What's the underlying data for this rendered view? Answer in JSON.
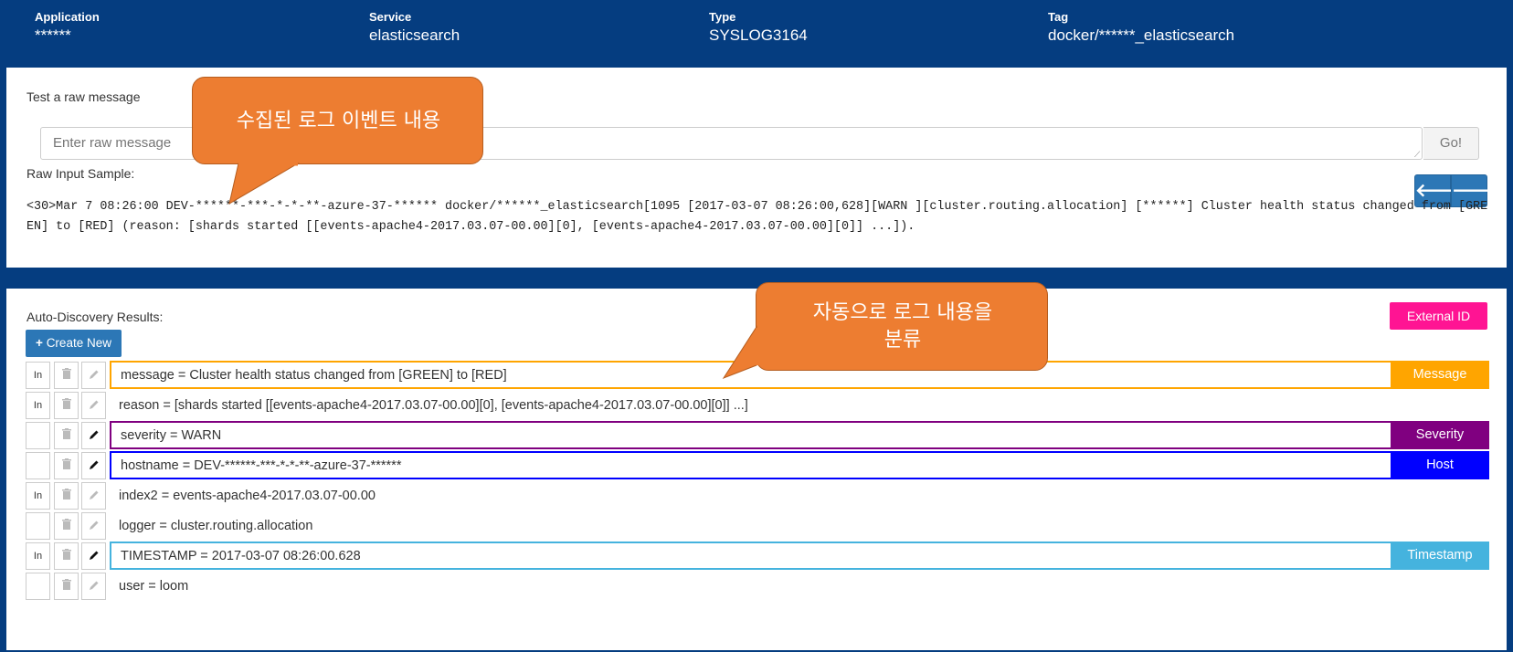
{
  "header": {
    "application": {
      "label": "Application",
      "value": "******"
    },
    "service": {
      "label": "Service",
      "value": "elasticsearch"
    },
    "type": {
      "label": "Type",
      "value": "SYSLOG3164"
    },
    "tag": {
      "label": "Tag",
      "value": "docker/******_elasticsearch"
    }
  },
  "test_panel": {
    "title": "Test a raw message",
    "input_placeholder": "Enter raw message",
    "go_label": "Go!",
    "sample_label": "Raw Input Sample:",
    "prev_icon": "arrow-left-icon",
    "next_icon": "arrow-right-icon",
    "sample_text": "<30>Mar 7 08:26:00 DEV-******-***-*-*-**-azure-37-****** docker/******_elasticsearch[1095 [2017-03-07 08:26:00,628][WARN ][cluster.routing.allocation] [******] Cluster health status changed from [GREEN] to [RED] (reason: [shards started [[events-apache4-2017.03.07-00.00][0], [events-apache4-2017.03.07-00.00][0]] ...])."
  },
  "callouts": {
    "top": "수집된 로그 이벤트 내용",
    "bottom_line1": "자동으로 로그 내용을",
    "bottom_line2": "분류"
  },
  "discovery": {
    "title": "Auto-Discovery Results:",
    "external_id_label": "External ID",
    "create_new_label": "Create New",
    "create_icon": "plus-icon",
    "in_label": "In",
    "rows": [
      {
        "text": "message = Cluster health status changed from [GREEN] to [RED]",
        "in": true,
        "edit_active": false,
        "tag": "Message",
        "color": "#ffa500"
      },
      {
        "text": "reason = [shards started [[events-apache4-2017.03.07-00.00][0], [events-apache4-2017.03.07-00.00][0]] ...]",
        "in": true,
        "edit_active": false,
        "tag": "",
        "color": ""
      },
      {
        "text": "severity = WARN",
        "in": false,
        "edit_active": true,
        "tag": "Severity",
        "color": "#800080"
      },
      {
        "text": "hostname = DEV-******-***-*-*-**-azure-37-******",
        "in": false,
        "edit_active": true,
        "tag": "Host",
        "color": "#0000ff"
      },
      {
        "text": "index2 = events-apache4-2017.03.07-00.00",
        "in": true,
        "edit_active": false,
        "tag": "",
        "color": ""
      },
      {
        "text": "logger = cluster.routing.allocation",
        "in": false,
        "edit_active": false,
        "tag": "",
        "color": ""
      },
      {
        "text": "TIMESTAMP = 2017-03-07 08:26:00.628",
        "in": true,
        "edit_active": true,
        "tag": "Timestamp",
        "color": "#45b3de"
      },
      {
        "text": "user = loom",
        "in": false,
        "edit_active": false,
        "tag": "",
        "color": ""
      }
    ]
  }
}
